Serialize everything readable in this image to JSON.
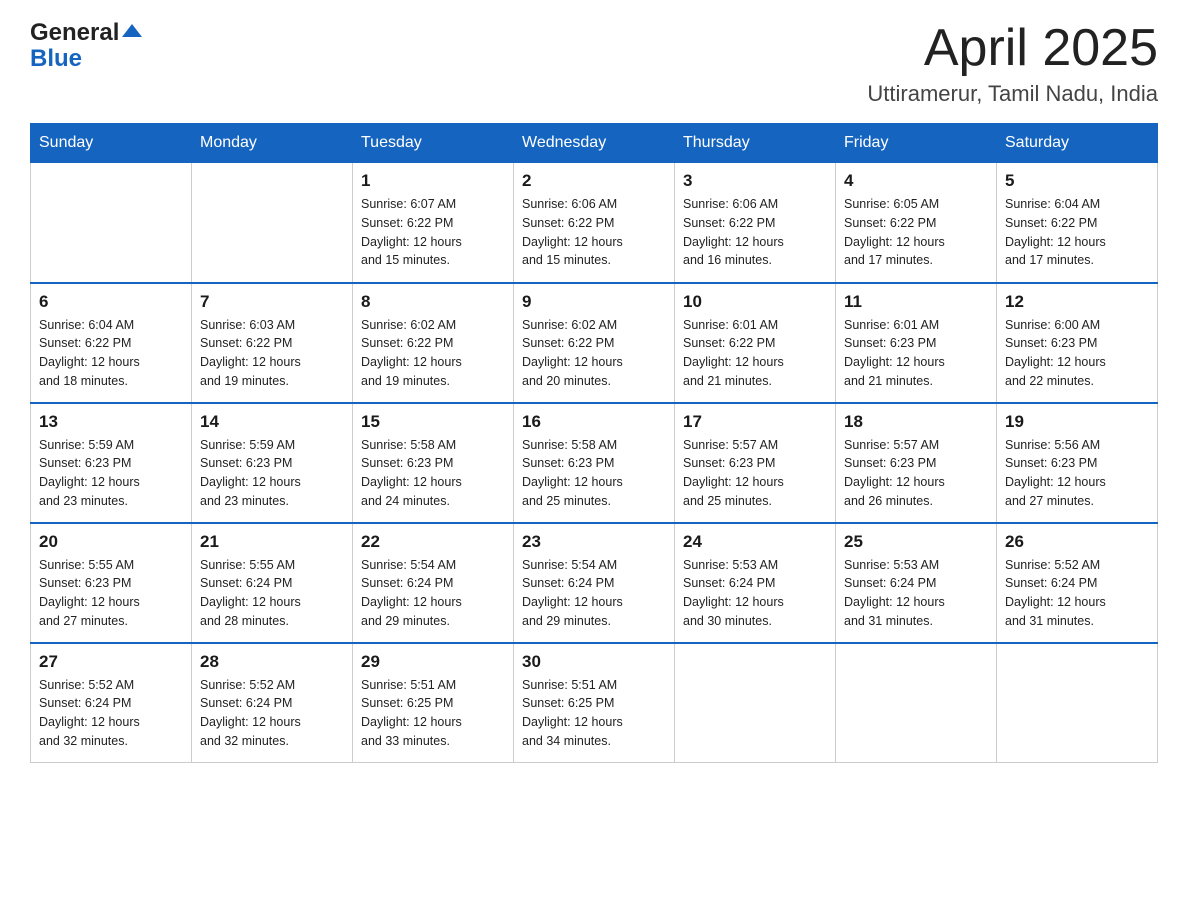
{
  "header": {
    "month_title": "April 2025",
    "location": "Uttiramerur, Tamil Nadu, India",
    "logo_general": "General",
    "logo_blue": "Blue"
  },
  "weekdays": [
    "Sunday",
    "Monday",
    "Tuesday",
    "Wednesday",
    "Thursday",
    "Friday",
    "Saturday"
  ],
  "weeks": [
    [
      {
        "day": "",
        "info": ""
      },
      {
        "day": "",
        "info": ""
      },
      {
        "day": "1",
        "info": "Sunrise: 6:07 AM\nSunset: 6:22 PM\nDaylight: 12 hours\nand 15 minutes."
      },
      {
        "day": "2",
        "info": "Sunrise: 6:06 AM\nSunset: 6:22 PM\nDaylight: 12 hours\nand 15 minutes."
      },
      {
        "day": "3",
        "info": "Sunrise: 6:06 AM\nSunset: 6:22 PM\nDaylight: 12 hours\nand 16 minutes."
      },
      {
        "day": "4",
        "info": "Sunrise: 6:05 AM\nSunset: 6:22 PM\nDaylight: 12 hours\nand 17 minutes."
      },
      {
        "day": "5",
        "info": "Sunrise: 6:04 AM\nSunset: 6:22 PM\nDaylight: 12 hours\nand 17 minutes."
      }
    ],
    [
      {
        "day": "6",
        "info": "Sunrise: 6:04 AM\nSunset: 6:22 PM\nDaylight: 12 hours\nand 18 minutes."
      },
      {
        "day": "7",
        "info": "Sunrise: 6:03 AM\nSunset: 6:22 PM\nDaylight: 12 hours\nand 19 minutes."
      },
      {
        "day": "8",
        "info": "Sunrise: 6:02 AM\nSunset: 6:22 PM\nDaylight: 12 hours\nand 19 minutes."
      },
      {
        "day": "9",
        "info": "Sunrise: 6:02 AM\nSunset: 6:22 PM\nDaylight: 12 hours\nand 20 minutes."
      },
      {
        "day": "10",
        "info": "Sunrise: 6:01 AM\nSunset: 6:22 PM\nDaylight: 12 hours\nand 21 minutes."
      },
      {
        "day": "11",
        "info": "Sunrise: 6:01 AM\nSunset: 6:23 PM\nDaylight: 12 hours\nand 21 minutes."
      },
      {
        "day": "12",
        "info": "Sunrise: 6:00 AM\nSunset: 6:23 PM\nDaylight: 12 hours\nand 22 minutes."
      }
    ],
    [
      {
        "day": "13",
        "info": "Sunrise: 5:59 AM\nSunset: 6:23 PM\nDaylight: 12 hours\nand 23 minutes."
      },
      {
        "day": "14",
        "info": "Sunrise: 5:59 AM\nSunset: 6:23 PM\nDaylight: 12 hours\nand 23 minutes."
      },
      {
        "day": "15",
        "info": "Sunrise: 5:58 AM\nSunset: 6:23 PM\nDaylight: 12 hours\nand 24 minutes."
      },
      {
        "day": "16",
        "info": "Sunrise: 5:58 AM\nSunset: 6:23 PM\nDaylight: 12 hours\nand 25 minutes."
      },
      {
        "day": "17",
        "info": "Sunrise: 5:57 AM\nSunset: 6:23 PM\nDaylight: 12 hours\nand 25 minutes."
      },
      {
        "day": "18",
        "info": "Sunrise: 5:57 AM\nSunset: 6:23 PM\nDaylight: 12 hours\nand 26 minutes."
      },
      {
        "day": "19",
        "info": "Sunrise: 5:56 AM\nSunset: 6:23 PM\nDaylight: 12 hours\nand 27 minutes."
      }
    ],
    [
      {
        "day": "20",
        "info": "Sunrise: 5:55 AM\nSunset: 6:23 PM\nDaylight: 12 hours\nand 27 minutes."
      },
      {
        "day": "21",
        "info": "Sunrise: 5:55 AM\nSunset: 6:24 PM\nDaylight: 12 hours\nand 28 minutes."
      },
      {
        "day": "22",
        "info": "Sunrise: 5:54 AM\nSunset: 6:24 PM\nDaylight: 12 hours\nand 29 minutes."
      },
      {
        "day": "23",
        "info": "Sunrise: 5:54 AM\nSunset: 6:24 PM\nDaylight: 12 hours\nand 29 minutes."
      },
      {
        "day": "24",
        "info": "Sunrise: 5:53 AM\nSunset: 6:24 PM\nDaylight: 12 hours\nand 30 minutes."
      },
      {
        "day": "25",
        "info": "Sunrise: 5:53 AM\nSunset: 6:24 PM\nDaylight: 12 hours\nand 31 minutes."
      },
      {
        "day": "26",
        "info": "Sunrise: 5:52 AM\nSunset: 6:24 PM\nDaylight: 12 hours\nand 31 minutes."
      }
    ],
    [
      {
        "day": "27",
        "info": "Sunrise: 5:52 AM\nSunset: 6:24 PM\nDaylight: 12 hours\nand 32 minutes."
      },
      {
        "day": "28",
        "info": "Sunrise: 5:52 AM\nSunset: 6:24 PM\nDaylight: 12 hours\nand 32 minutes."
      },
      {
        "day": "29",
        "info": "Sunrise: 5:51 AM\nSunset: 6:25 PM\nDaylight: 12 hours\nand 33 minutes."
      },
      {
        "day": "30",
        "info": "Sunrise: 5:51 AM\nSunset: 6:25 PM\nDaylight: 12 hours\nand 34 minutes."
      },
      {
        "day": "",
        "info": ""
      },
      {
        "day": "",
        "info": ""
      },
      {
        "day": "",
        "info": ""
      }
    ]
  ]
}
